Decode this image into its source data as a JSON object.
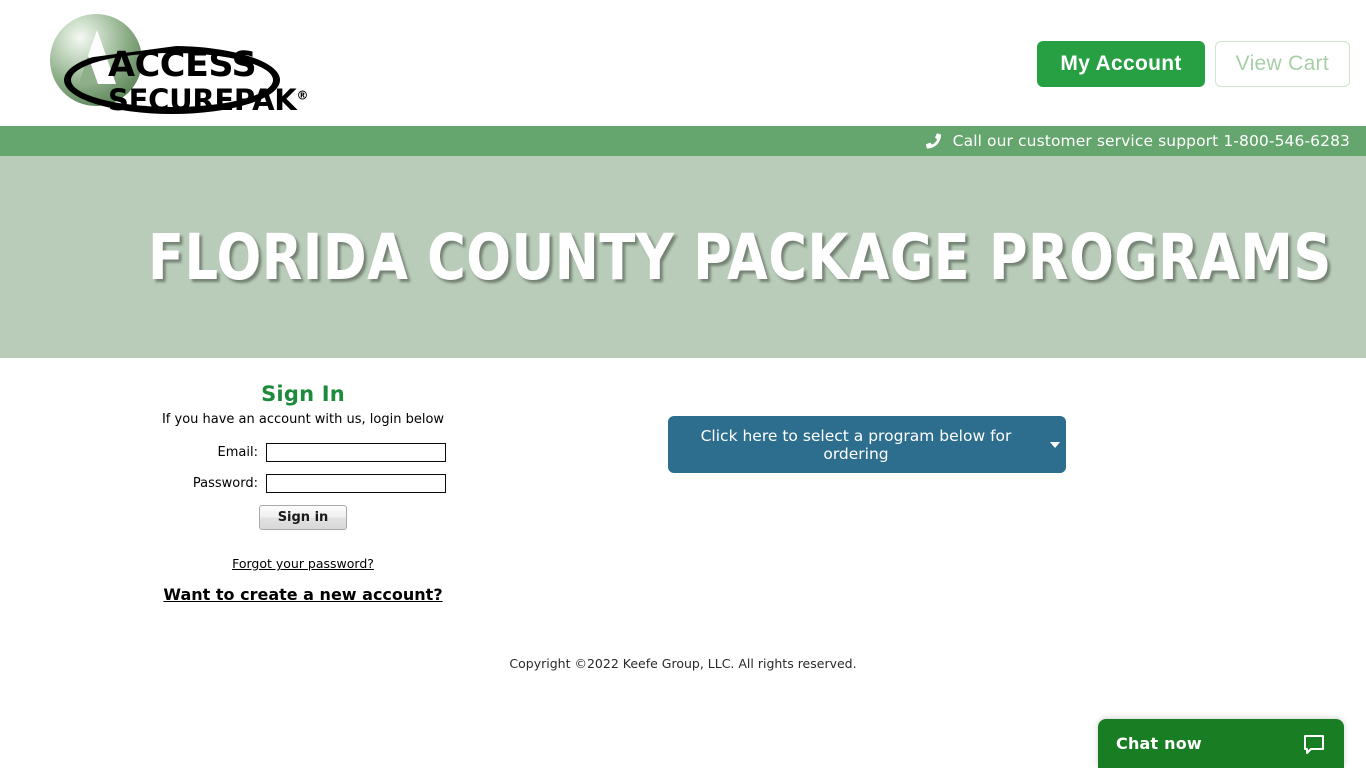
{
  "header": {
    "logo": {
      "line1": "ACCESS",
      "line2": "SECUREPAK",
      "registered": "®",
      "icon": "access-securepak-logo"
    },
    "my_account_label": "My Account",
    "view_cart_label": "View Cart"
  },
  "phonebar": {
    "icon": "phone-icon",
    "text": "Call our customer service support 1-800-546-6283"
  },
  "banner": {
    "title": "FLORIDA COUNTY PACKAGE PROGRAMS"
  },
  "signin": {
    "title": "Sign In",
    "subtitle": "If you have an account with us, login below",
    "email_label": "Email:",
    "email_value": "",
    "email_placeholder": "",
    "password_label": "Password:",
    "password_value": "",
    "password_placeholder": "",
    "submit_label": "Sign in",
    "forgot_link": "Forgot your password?",
    "create_link": "Want to create a new account?"
  },
  "program": {
    "button_label": "Click here to select a program below for ordering",
    "caret_icon": "chevron-down-icon"
  },
  "footer": {
    "copyright": "Copyright ©2022 Keefe Group, LLC. All rights reserved."
  },
  "chat": {
    "label": "Chat now",
    "icon": "chat-bubble-icon"
  },
  "colors": {
    "brand_green": "#27a044",
    "phonebar_green": "#65a66f",
    "banner_sage": "#b9ccb9",
    "signin_green": "#1e8a3c",
    "program_blue": "#2d6e8e",
    "chat_green": "#197d24"
  }
}
